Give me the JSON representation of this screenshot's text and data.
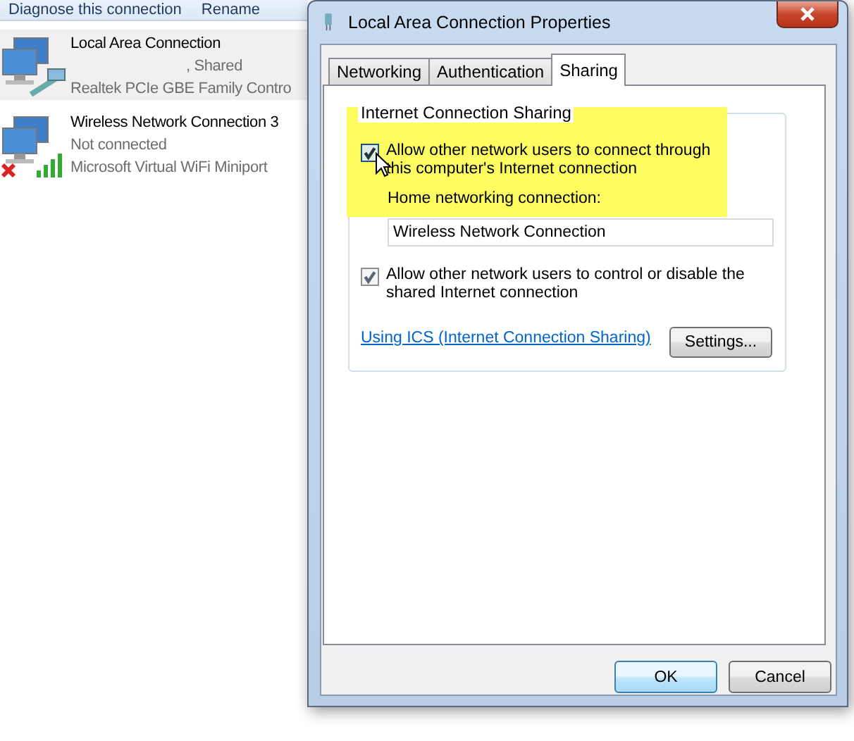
{
  "background_window": {
    "toolbar": [
      "Diagnose this connection",
      "Rename"
    ],
    "connections": [
      {
        "kind": "wired",
        "name": "Local Area Connection",
        "status": ", Shared",
        "device": "Realtek PCIe GBE Family Contro",
        "selected": true
      },
      {
        "kind": "wireless",
        "name": "Wireless Network Connection 3",
        "status": "Not connected",
        "device": "Microsoft Virtual WiFi Miniport",
        "selected": false
      }
    ]
  },
  "dialog": {
    "title": "Local Area Connection Properties",
    "tabs": [
      {
        "label": "Networking",
        "selected": false
      },
      {
        "label": "Authentication",
        "selected": false
      },
      {
        "label": "Sharing",
        "selected": true
      }
    ],
    "group_title": "Internet Connection Sharing",
    "allow_connect": {
      "label": "Allow other network users to connect through this computer's Internet connection",
      "checked": true
    },
    "home_label": "Home networking connection:",
    "home_value": "Wireless Network Connection",
    "allow_control": {
      "label": "Allow other network users to control or disable the shared Internet connection",
      "checked": true
    },
    "link": "Using ICS (Internet Connection Sharing)",
    "settings_button": "Settings...",
    "buttons": [
      "OK",
      "Cancel"
    ]
  }
}
